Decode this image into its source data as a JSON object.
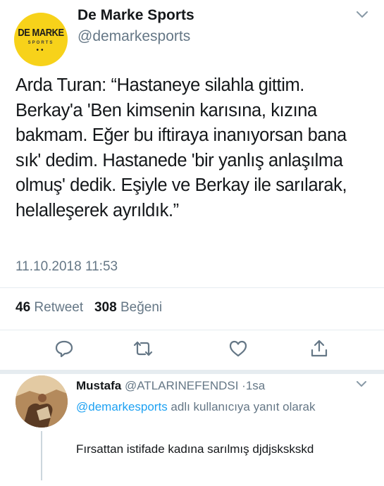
{
  "tweet": {
    "avatar": {
      "logo_text": "DE MARKE",
      "logo_sub": "SPORTS",
      "logo_dots": "••"
    },
    "display_name": "De Marke Sports",
    "handle": "@demarkesports",
    "text": "Arda Turan: “Hastaneye silahla gittim. Berkay'a 'Ben kimsenin karısına, kızına bakmam. Eğer bu iftiraya inanıyorsan bana sık' dedim. Hastanede 'bir yanlış anlaşılma olmuş' dedik. Eşiyle ve Berkay ile sarılarak, helalleşerek ayrıldık.”",
    "timestamp": "11.10.2018 11:53",
    "retweet_count": "46",
    "retweet_label": "Retweet",
    "like_count": "308",
    "like_label": "Beğeni"
  },
  "actions": [
    "reply-icon",
    "retweet-icon",
    "like-icon",
    "share-icon"
  ],
  "reply": {
    "name": "Mustafa",
    "handle": "@ATLARINEFENDSI",
    "separator": "·",
    "time": "1sa",
    "reply_to_mention": "@demarkesports",
    "reply_to_suffix": " adlı kullanıcıya yanıt olarak",
    "text": "Fırsattan istifade kadına sarılmış djdjskskskd"
  },
  "colors": {
    "primary_text": "#14171a",
    "secondary_text": "#657786",
    "accent": "#1da1f2",
    "avatar_yellow": "#f7d21a"
  }
}
